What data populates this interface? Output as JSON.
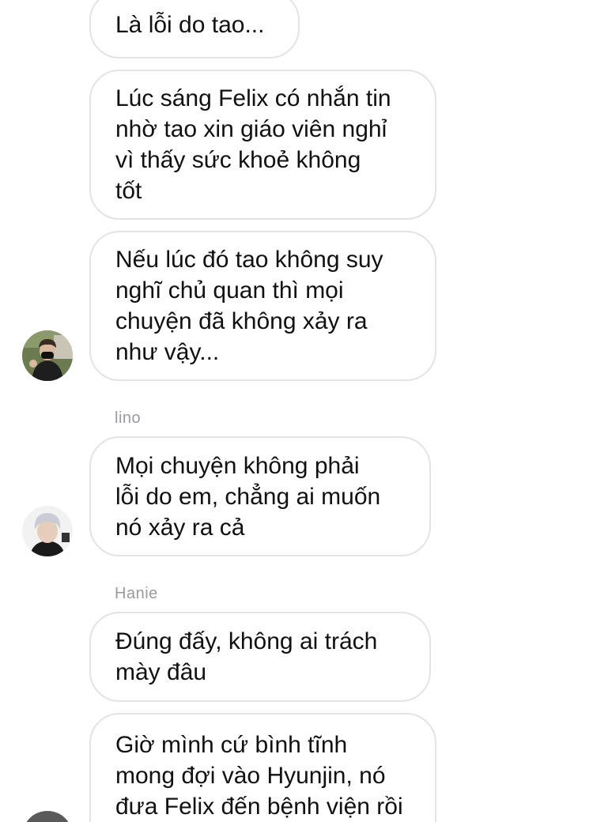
{
  "messages": [
    {
      "id": "m1",
      "text": "Là lỗi do tao..."
    },
    {
      "id": "m2",
      "text": "Lúc sáng Felix có nhắn tin\nnhờ tao xin giáo viên nghỉ\nvì thấy sức khoẻ không\ntốt"
    },
    {
      "id": "m3",
      "text": "Nếu lúc đó tao không suy\nnghĩ chủ quan thì mọi\nchuyện đã không xảy ra\nnhư vậy..."
    },
    {
      "id": "m4",
      "sender": "lino",
      "text": "Mọi chuyện không phải\nlỗi do em, chẳng ai muốn\nnó xảy ra cả"
    },
    {
      "id": "m5",
      "sender": "Hanie",
      "text": "Đúng đấy, không ai trách\nmày đâu"
    },
    {
      "id": "m6",
      "text": "Giờ mình cứ bình tĩnh\nmong đợi vào Hyunjin, nó\nđưa Felix đến bệnh viện rồi"
    }
  ],
  "colors": {
    "bubble_border": "#e3e3e6",
    "bubble_text": "#111111",
    "sender_name": "#9a9a9f",
    "background": "#ffffff"
  },
  "avatars": [
    {
      "owner": "previous-sender",
      "icon": "profile-photo-masked-person"
    },
    {
      "owner": "lino",
      "icon": "profile-photo-silver-hair"
    },
    {
      "owner": "Hanie",
      "icon": "profile-photo"
    }
  ]
}
